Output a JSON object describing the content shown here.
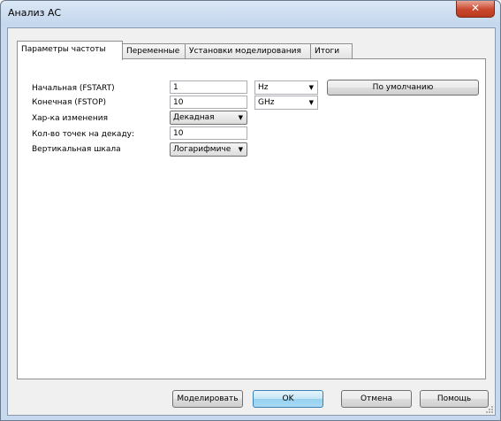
{
  "window": {
    "title": "Анализ AC",
    "close_glyph": "✕"
  },
  "tabs": [
    {
      "label": "Параметры частоты",
      "active": true
    },
    {
      "label": "Переменные"
    },
    {
      "label": "Установки моделирования"
    },
    {
      "label": "Итоги"
    }
  ],
  "form": {
    "fstart": {
      "label": "Начальная (FSTART)",
      "value": "1",
      "unit": "Hz"
    },
    "fstop": {
      "label": "Конечная (FSTOP)",
      "value": "10",
      "unit": "GHz"
    },
    "sweep": {
      "label": "Хар-ка изменения",
      "value": "Декадная"
    },
    "points": {
      "label": "Кол-во точек на декаду:",
      "value": "10"
    },
    "vscale": {
      "label": "Вертикальная шкала",
      "value": "Логарифмиче"
    },
    "default_button": "По умолчанию"
  },
  "buttons": {
    "simulate": "Моделировать",
    "ok": "OK",
    "cancel": "Отмена",
    "help": "Помощь"
  },
  "icons": {
    "dropdown": "▼"
  }
}
